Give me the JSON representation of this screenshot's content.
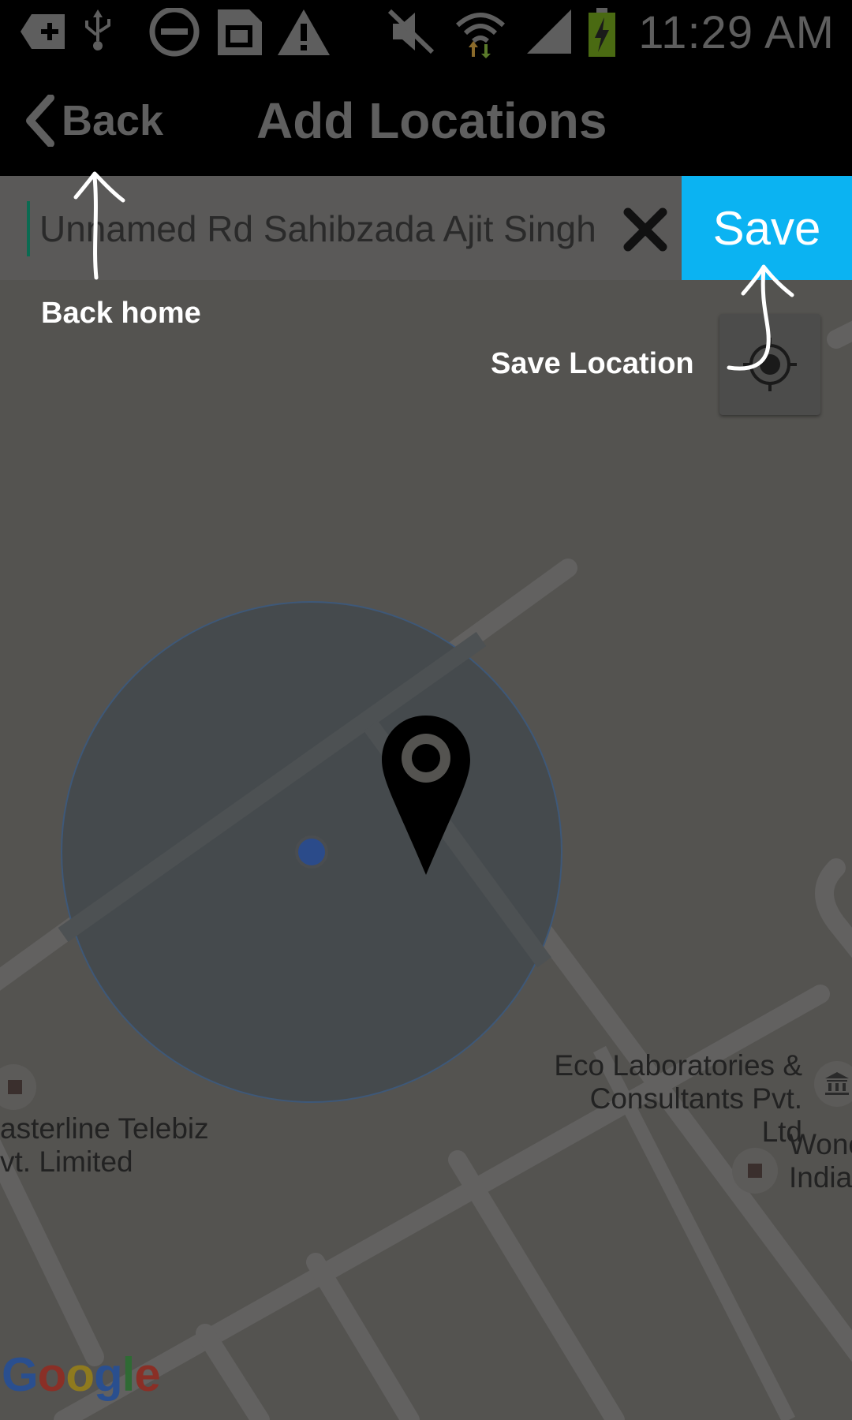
{
  "status_bar": {
    "time": "11:29 AM",
    "icons": [
      "add-icon",
      "usb-icon",
      "do-not-disturb-icon",
      "sim-card-icon",
      "warning-icon",
      "mute-icon",
      "wifi-icon",
      "signal-icon",
      "battery-charging-icon"
    ]
  },
  "app_bar": {
    "back_label": "Back",
    "title": "Add Locations"
  },
  "search": {
    "value": "Unnamed Rd Sahibzada Ajit Singh"
  },
  "toolbar": {
    "save_label": "Save"
  },
  "map": {
    "pois": [
      {
        "label_line1": "Eco Laboratories &",
        "label_line2": "Consultants Pvt. Ltd"
      },
      {
        "label_line1": "asterline Telebiz",
        "label_line2": "vt. Limited"
      },
      {
        "label_line1": "Wonc",
        "label_line2": "India"
      }
    ],
    "attribution": "Google"
  },
  "annotations": {
    "back_hint": "Back home",
    "save_hint": "Save Location"
  },
  "colors": {
    "accent": "#0bb3f2",
    "overlay": "#545350",
    "marker_dot": "#2b4b8a"
  }
}
